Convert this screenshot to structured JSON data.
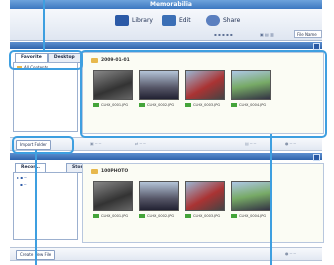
{
  "window": {
    "app_title": "Memorabilia"
  },
  "toolbar": {
    "library_label": "Library",
    "edit_label": "Edit",
    "share_label": "Share",
    "sort_value": "File Name"
  },
  "top_pane": {
    "tabs": [
      "Favorite",
      "Desktop"
    ],
    "tree_item": "All Contents",
    "folder_name": "2009-01-01",
    "files": [
      "CLHX_0001.JPG",
      "CLHX_0002.JPG",
      "CLHX_0003.JPG",
      "CLHX_0004.JPG"
    ]
  },
  "top_actions": {
    "import_label": "Import Folder"
  },
  "bottom_pane": {
    "tabs": [
      "Recor...",
      "Storage"
    ],
    "folder_name": "100PHOTO",
    "files": [
      "CLHX_0001.JPG",
      "CLHX_0002.JPG",
      "CLHX_0003.JPG",
      "CLHX_0004.JPG"
    ]
  },
  "bottom_actions": {
    "new_folder_label": "Create New File"
  },
  "colors": {
    "callout": "#3e9fe0",
    "header": "#2f64ad"
  }
}
